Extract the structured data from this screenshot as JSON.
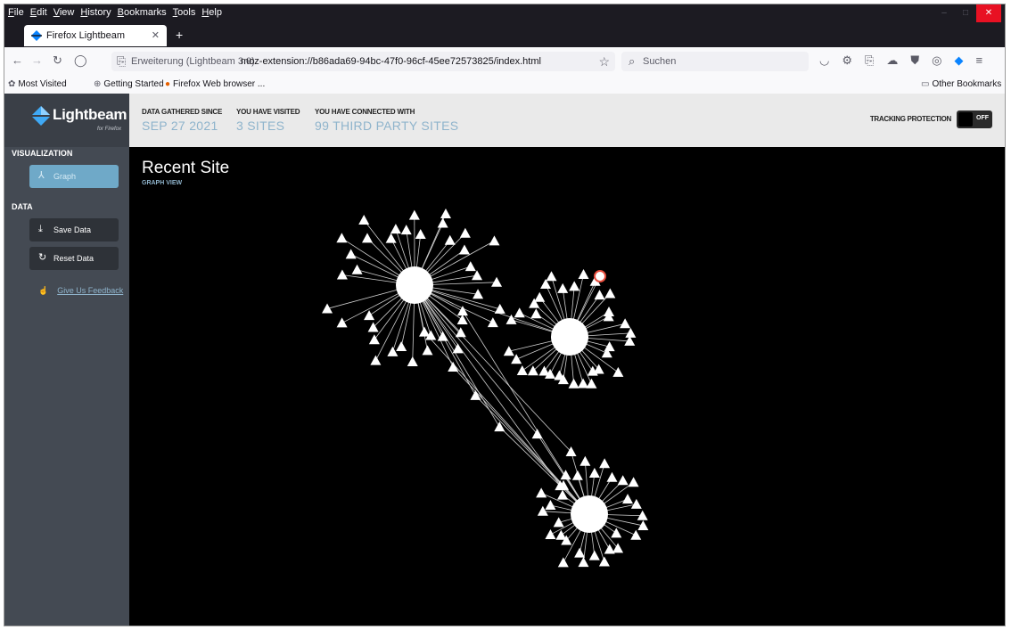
{
  "browser": {
    "menu": [
      "File",
      "Edit",
      "View",
      "History",
      "Bookmarks",
      "Tools",
      "Help"
    ],
    "tab_title": "Firefox Lightbeam",
    "url_prefix": "Erweiterung (Lightbeam 3.0)",
    "url": "moz-extension://b86ada69-94bc-47f0-96cf-45ee72573825/index.html",
    "search_placeholder": "Suchen",
    "bookmarks": [
      "Most Visited",
      "Getting Started",
      "Firefox Web browser ...",
      "Other Bookmarks"
    ]
  },
  "app": {
    "logo_name": "Lightbeam",
    "logo_sub": "for Firefox",
    "visualization_heading": "VISUALIZATION",
    "graph_label": "Graph",
    "data_heading": "DATA",
    "save_label": "Save Data",
    "reset_label": "Reset Data",
    "feedback_label": "Give Us Feedback",
    "stats": [
      {
        "label": "DATA GATHERED SINCE",
        "value": "SEP 27 2021"
      },
      {
        "label": "YOU HAVE VISITED",
        "value": "3 SITES"
      },
      {
        "label": "YOU HAVE CONNECTED WITH",
        "value": "99 THIRD PARTY SITES"
      }
    ],
    "tracking_label": "TRACKING PROTECTION",
    "tracking_state": "OFF",
    "view_title": "Recent Site",
    "view_subtitle": "GRAPH VIEW"
  },
  "graph": {
    "visited_sites": 3,
    "third_party_count": 99
  },
  "colors": {
    "accent": "#6fa9c8",
    "accent_text": "#8fb4cc",
    "sidebar": "#444a53",
    "canvas": "#000000",
    "header": "#eaeaea"
  }
}
